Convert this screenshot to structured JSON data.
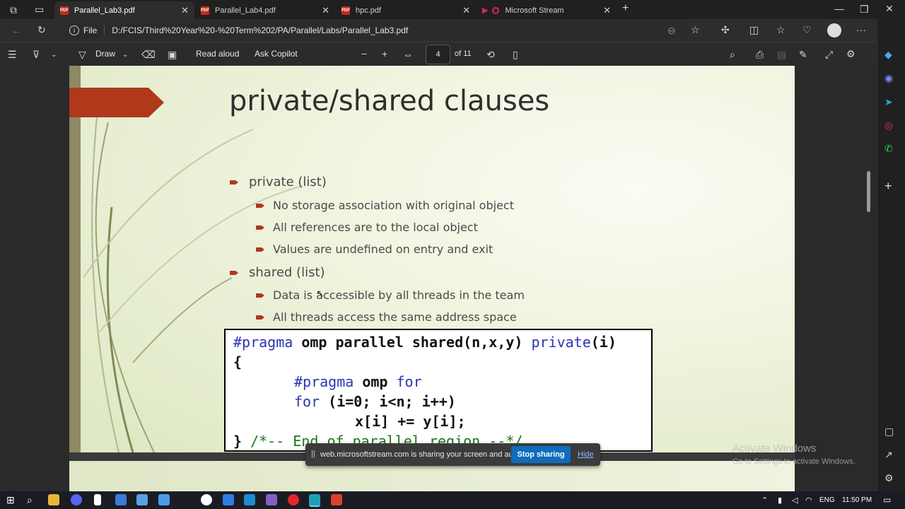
{
  "browser": {
    "tabs": [
      {
        "label": "Parallel_Lab3.pdf",
        "active": true
      },
      {
        "label": "Parallel_Lab4.pdf",
        "active": false
      },
      {
        "label": "hpc.pdf",
        "active": false
      },
      {
        "label": "Microsoft Stream",
        "active": false
      }
    ],
    "url_scheme": "File",
    "url": "D:/FCIS/Third%20Year%20-%20Term%202/PA/Parallel/Labs/Parallel_Lab3.pdf"
  },
  "pdf_toolbar": {
    "draw_label": "Draw",
    "read_aloud_label": "Read aloud",
    "ask_copilot_label": "Ask Copilot",
    "page_number": "4",
    "page_total": "of 11"
  },
  "slide": {
    "title": "private/shared clauses",
    "bullets": [
      {
        "text": "private (list)",
        "sub": [
          "No storage association with original object",
          "All references are to the local object",
          "Values are undefined on entry and exit"
        ]
      },
      {
        "text": "shared (list)",
        "sub": [
          "Data is accessible by all threads in the team",
          "All threads access the same address space"
        ]
      }
    ],
    "code": {
      "l1_kw": "#pragma",
      "l1_rest": " omp parallel shared(n,x,y) ",
      "l1_kw2": "private",
      "l1_end": "(i)",
      "l2": "{",
      "l3_kw": "#pragma",
      "l3_mid": " omp ",
      "l3_kw2": "for",
      "l4_kw": "for",
      "l4_rest": " (i=0; i<n; i++)",
      "l5": "x[i] += y[i];",
      "l6_brace": "} ",
      "l6_comment": "/*-- End of parallel region --*/"
    }
  },
  "share_bar": {
    "message": "web.microsoftstream.com is sharing your screen and audio.",
    "stop_label": "Stop sharing",
    "hide_label": "Hide"
  },
  "watermark": {
    "line1": "Activate Windows",
    "line2": "Go to Settings to activate Windows."
  },
  "taskbar": {
    "lang": "ENG",
    "time": "11:50 PM"
  }
}
